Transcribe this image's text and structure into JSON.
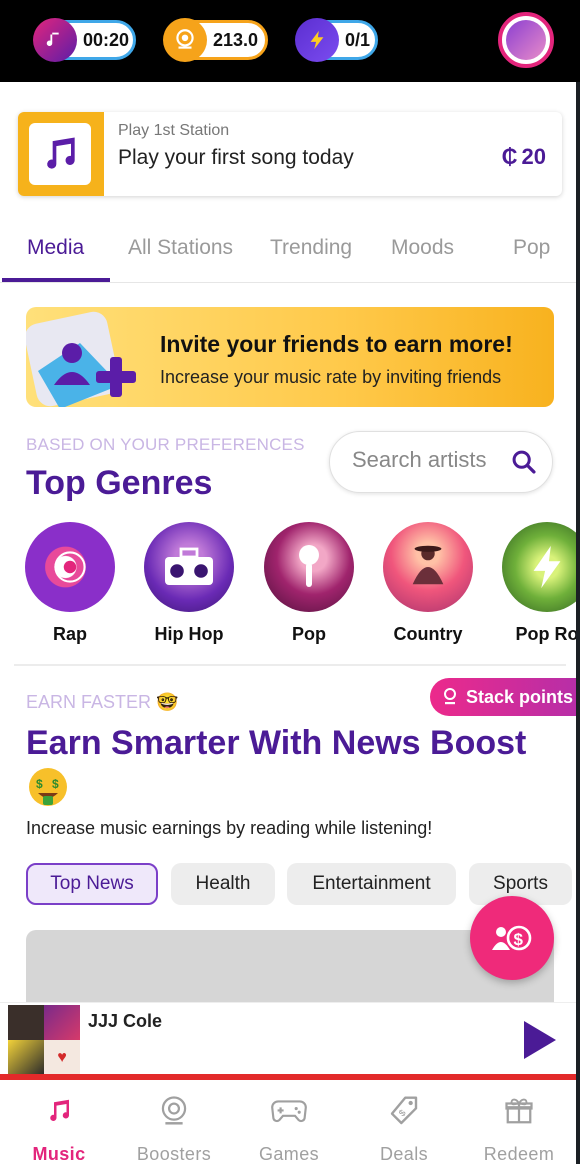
{
  "topbar": {
    "timer": "00:20",
    "coins": "213.0",
    "boosts": "0/1",
    "icons": [
      "music-note-icon",
      "coin-icon",
      "lightning-icon",
      "profile-avatar"
    ]
  },
  "station": {
    "subtitle": "Play 1st Station",
    "title": "Play your first song today",
    "reward": "20",
    "reward_icon": "currency-icon"
  },
  "tabs": [
    {
      "label": "Media",
      "active": true
    },
    {
      "label": "All Stations",
      "active": false
    },
    {
      "label": "Trending",
      "active": false
    },
    {
      "label": "Moods",
      "active": false
    },
    {
      "label": "Pop",
      "active": false
    }
  ],
  "invite": {
    "title": "Invite your friends to earn more!",
    "subtitle": "Increase your music rate by inviting friends"
  },
  "genres": {
    "eyebrow": "BASED ON YOUR PREFERENCES",
    "title": "Top Genres",
    "search_placeholder": "Search artists",
    "items": [
      {
        "label": "Rap",
        "color": "#8a2fc9"
      },
      {
        "label": "Hip Hop",
        "color": "#6a2ab5"
      },
      {
        "label": "Pop",
        "color": "#a0246d"
      },
      {
        "label": "Country",
        "color": "#f0567c"
      },
      {
        "label": "Pop Ro",
        "color": "#6fb03a"
      }
    ]
  },
  "news": {
    "eyebrow": "EARN FASTER 🤓",
    "stack_label": "Stack points",
    "title": "Earn Smarter With News Boost",
    "subtitle": "Increase music earnings by reading while listening!",
    "chips": [
      {
        "label": "Top News",
        "active": true
      },
      {
        "label": "Health",
        "active": false
      },
      {
        "label": "Entertainment",
        "active": false
      },
      {
        "label": "Sports",
        "active": false
      }
    ]
  },
  "player": {
    "title": "JJJ Cole"
  },
  "nav": [
    {
      "label": "Music",
      "icon": "music-note-icon",
      "active": true
    },
    {
      "label": "Boosters",
      "icon": "booster-icon",
      "active": false
    },
    {
      "label": "Games",
      "icon": "gamepad-icon",
      "active": false
    },
    {
      "label": "Deals",
      "icon": "tag-icon",
      "active": false
    },
    {
      "label": "Redeem",
      "icon": "gift-icon",
      "active": false
    }
  ],
  "colors": {
    "brand_purple": "#4b1b96",
    "accent_pink": "#e3257c",
    "gold": "#f6b21b"
  }
}
